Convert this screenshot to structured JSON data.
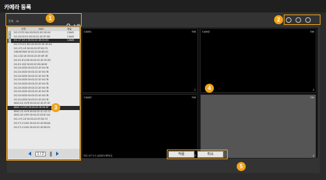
{
  "header": {
    "title": "카메라 등록"
  },
  "search": {
    "total_label": "전체 : 28",
    "button_label": "스캔"
  },
  "list": {
    "columns": [
      "순번",
      "MAC",
      "채널"
    ],
    "rows": [
      {
        "num": "1",
        "mac": "DC-07:E1:DA 00:03:22:1E:1E:A3",
        "cam": "CAM1",
        "sel": false,
        "assigned": true
      },
      {
        "num": "2",
        "mac": "DC-02:02:EX 00:03:22:1E:2F:5D",
        "cam": "CAM2",
        "sel": false,
        "assigned": true
      },
      {
        "num": "3",
        "mac": "DC-V7:1E:1 00:03:22:1B:21:DC",
        "cam": "CAM3",
        "sel": true,
        "assigned": true
      },
      {
        "num": "",
        "mac": "DC-071:E1:DN 00:03:22:1E:1E:A1",
        "cam": "",
        "sel": false,
        "assigned": false
      },
      {
        "num": "",
        "mac": "DC-V71:1E 00:03:22:2F:B2:70",
        "cam": "",
        "sel": false,
        "assigned": false
      },
      {
        "num": "",
        "mac": "UNKNOWN 00:03:22:30:5D:2C",
        "cam": "",
        "sel": false,
        "assigned": false
      },
      {
        "num": "",
        "mac": "DC-C32:1E 00:03:22:2E:8F:2E",
        "cam": "",
        "sel": false,
        "assigned": false
      },
      {
        "num": "",
        "mac": "DC-E1:E1:DN 00:03:22:1E:22:D2",
        "cam": "",
        "sel": false,
        "assigned": false
      },
      {
        "num": "",
        "mac": "DC-E1:032 00:03:22:25:1B:59",
        "cam": "",
        "sel": false,
        "assigned": false
      },
      {
        "num": "",
        "mac": "DC-51:0025 00:03:22:1E:94:7B",
        "cam": "",
        "sel": false,
        "assigned": false
      },
      {
        "num": "",
        "mac": "DC-51:0025 00:03:22:1E:94:7B",
        "cam": "",
        "sel": false,
        "assigned": false
      },
      {
        "num": "",
        "mac": "DC-51:0025 00:03:22:1E:94:7B",
        "cam": "",
        "sel": false,
        "assigned": false
      },
      {
        "num": "",
        "mac": "DC-51:0025 00:03:22:1E:94:7B",
        "cam": "",
        "sel": false,
        "assigned": false
      },
      {
        "num": "",
        "mac": "DC-51:0025 00:03:22:1E:94:7B",
        "cam": "",
        "sel": false,
        "assigned": false
      },
      {
        "num": "",
        "mac": "DC-51:0025 00:03:22:1E:94:7B",
        "cam": "",
        "sel": false,
        "assigned": false
      },
      {
        "num": "",
        "mac": "DC-51:0025 00:03:22:1E:94:7B",
        "cam": "",
        "sel": false,
        "assigned": false
      },
      {
        "num": "",
        "mac": "DC-51:0025 00:03:22:1E:94:7B",
        "cam": "",
        "sel": false,
        "assigned": false
      },
      {
        "num": "",
        "mac": "DC-51:0025 00:03:22:1E:94:7B",
        "cam": "",
        "sel": false,
        "assigned": false
      },
      {
        "num": "",
        "mac": "MNC-E1:VVR 00:03:22:1E:2F:87",
        "cam": "",
        "sel": false,
        "assigned": false
      },
      {
        "num": "",
        "mac": "MNC-V:VVR 00:03:22:1E:94:3F",
        "cam": "",
        "sel": true,
        "assigned": false
      },
      {
        "num": "",
        "mac": "MNC-V1:VVR 00:03:22:1C:2C:37",
        "cam": "",
        "sel": false,
        "assigned": false
      },
      {
        "num": "",
        "mac": "MNC-52:VVR 00:03:22:1E:87:A4",
        "cam": "",
        "sel": false,
        "assigned": false
      },
      {
        "num": "",
        "mac": "DC-V71:1E 00:03:22:2F:B2:70",
        "cam": "",
        "sel": false,
        "assigned": false
      },
      {
        "num": "",
        "mac": "DC-F1:2:3:8V 00:03:22:1E:55:8A",
        "cam": "",
        "sel": false,
        "assigned": false
      },
      {
        "num": "",
        "mac": "DC-F1:2:3:8V 00:03:22:1E:55:03",
        "cam": "",
        "sel": false,
        "assigned": false
      }
    ]
  },
  "pager": {
    "page": "1 / 2"
  },
  "cameras": [
    {
      "name": "CAM1",
      "res": "SM",
      "idx": "1",
      "bottom": ""
    },
    {
      "name": "CAM2",
      "res": "SM",
      "idx": "2",
      "bottom": ""
    },
    {
      "name": "CAM3",
      "res": "SM",
      "idx": "3",
      "bottom": "DC-V7:1:1 (2A21:EDC)"
    },
    {
      "name": "",
      "res": "SM",
      "idx": "4",
      "bottom": ""
    }
  ],
  "actions": {
    "apply_label": "적용",
    "cancel_label": "취소"
  },
  "callouts": [
    "1",
    "2",
    "3",
    "4",
    "5"
  ],
  "colors": {
    "accent": "#f0a41a",
    "pager_arrow": "#1b5fb0"
  }
}
